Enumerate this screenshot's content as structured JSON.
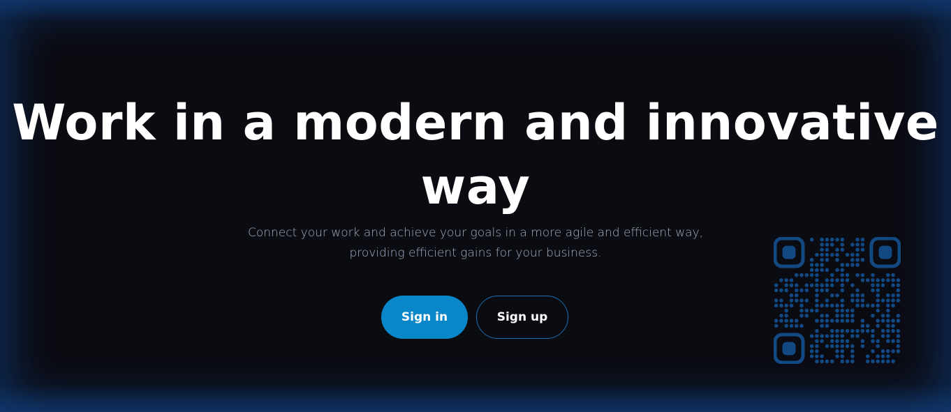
{
  "hero": {
    "headline_line1": "Work in a modern and innovative",
    "headline_line2": "way",
    "subtitle_line1": "Connect your work and achieve your goals in a more agile and efficient way,",
    "subtitle_line2": "providing efficient gains for your business."
  },
  "actions": {
    "signin_label": "Sign in",
    "signup_label": "Sign up"
  },
  "colors": {
    "background": "#0b0b12",
    "accent": "#0a87c9",
    "outline": "#1d6fb3",
    "qr": "#14508f"
  },
  "icons": {
    "qr": "qr-code-icon"
  }
}
